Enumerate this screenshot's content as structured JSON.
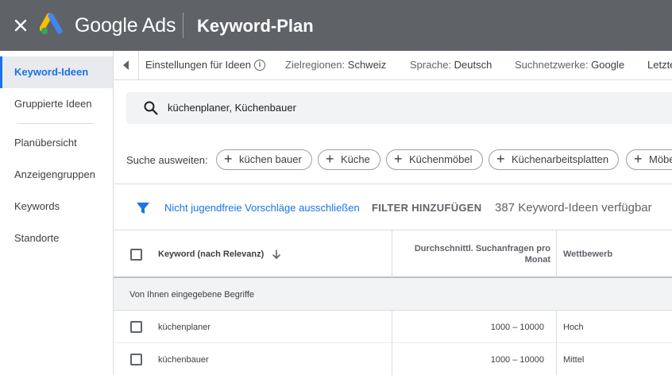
{
  "header": {
    "brand": "Google Ads",
    "title": "Keyword-Plan",
    "colors": {
      "bar": "#5f6368",
      "logo_blue": "#4285f4",
      "logo_yellow": "#fbbc04",
      "logo_green": "#34a853"
    }
  },
  "sidebar": {
    "items": [
      {
        "label": "Keyword-Ideen",
        "active": true
      },
      {
        "label": "Gruppierte Ideen"
      },
      {
        "label": "Planübersicht"
      },
      {
        "label": "Anzeigengruppen"
      },
      {
        "label": "Keywords"
      },
      {
        "label": "Standorte"
      }
    ]
  },
  "settings": {
    "ideas_settings": "Einstellungen für Ideen",
    "info_glyph": "i",
    "regions_label": "Zielregionen:",
    "regions_value": "Schweiz",
    "language_label": "Sprache:",
    "language_value": "Deutsch",
    "networks_label": "Suchnetzwerke:",
    "networks_value": "Google",
    "last_truncated": "Letzte"
  },
  "search": {
    "value": "küchenplaner, Küchenbauer",
    "icon": "search-icon"
  },
  "expand": {
    "label": "Suche ausweiten:",
    "chips": [
      "küchen bauer",
      "Küche",
      "Küchenmöbel",
      "Küchenarbeitsplatten",
      "Möbe"
    ]
  },
  "filter": {
    "exclude_adult": "Nicht jugendfreie Vorschläge ausschließen",
    "add_filter": "FILTER HINZUFÜGEN",
    "ideas_available": "387 Keyword-Ideen verfügbar",
    "accent": "#1a73e8"
  },
  "table": {
    "columns": {
      "keyword": "Keyword (nach Relevanz)",
      "avg_searches": "Durchschnittl. Suchanfragen pro Monat",
      "competition": "Wettbewerb"
    },
    "group_label": "Von Ihnen eingegebene Begriffe",
    "rows": [
      {
        "keyword": "küchenplaner",
        "avg": "1000 – 10000",
        "competition": "Hoch"
      },
      {
        "keyword": "küchenbauer",
        "avg": "1000 – 10000",
        "competition": "Mittel"
      }
    ]
  }
}
